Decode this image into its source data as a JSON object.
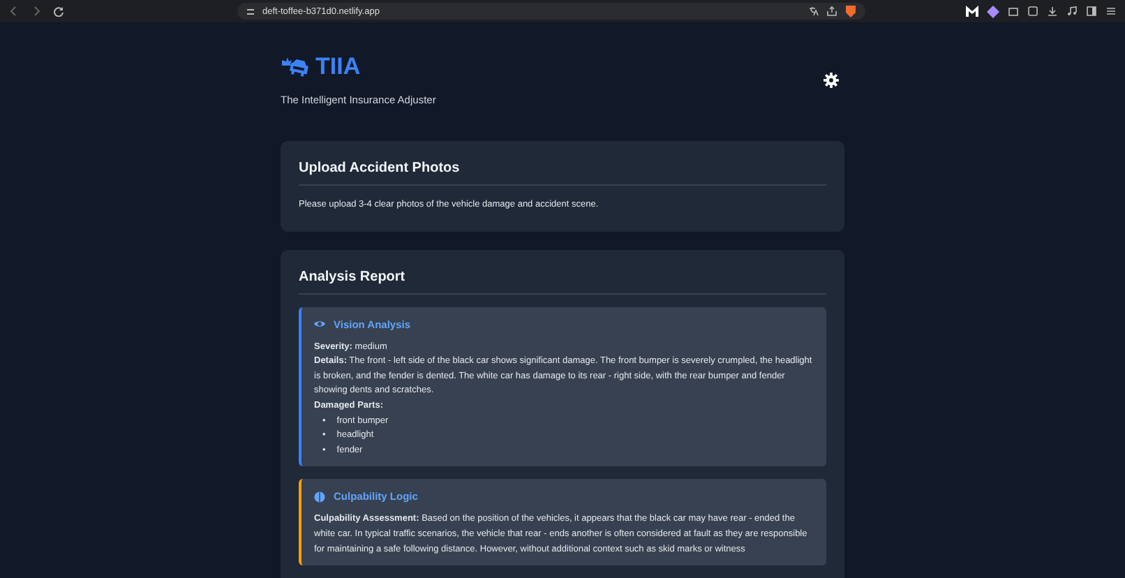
{
  "browser": {
    "url": "deft-toffee-b371d0.netlify.app"
  },
  "header": {
    "title": "TIIA",
    "subtitle": "The Intelligent Insurance Adjuster"
  },
  "upload": {
    "title": "Upload Accident Photos",
    "instructions": "Please upload 3-4 clear photos of the vehicle damage and accident scene."
  },
  "report": {
    "title": "Analysis Report",
    "sections": [
      {
        "kind": "vision",
        "title": "Vision Analysis",
        "lines": [
          "**Severity:** medium",
          "**Details:** The front - left side of the black car shows significant damage. The front bumper is severely crumpled, the headlight is broken, and the fender is dented. The white car has damage to its rear - right side, with the rear bumper and fender showing dents and scratches."
        ],
        "list_title": "Damaged Parts:",
        "bullet": "•",
        "list": [
          "front bumper",
          "headlight",
          "fender"
        ]
      },
      {
        "kind": "logic",
        "title": "Culpability Logic",
        "lines": [
          "**Culpability Assessment:** Based on the position of the vehicles, it appears that the black car may have rear - ended the white car. In typical traffic scenarios, the vehicle that rear - ends another is often considered at fault as they are responsible for maintaining a safe following distance. However, without additional context such as skid marks or witness"
        ]
      }
    ]
  }
}
